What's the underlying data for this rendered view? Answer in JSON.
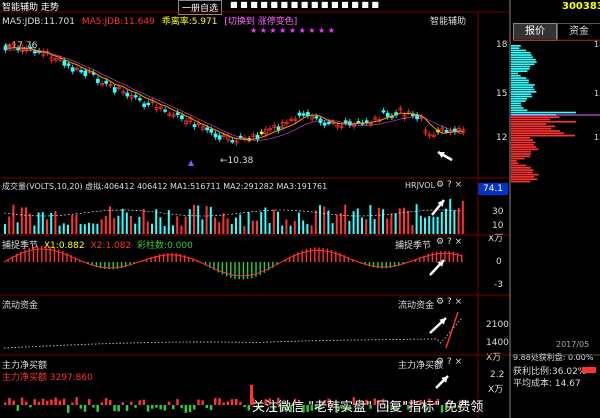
{
  "top_bar": {
    "left_tabs": "智能辅助 走势",
    "quick_menu": "一册自选"
  },
  "main_chart": {
    "legend": [
      "MA5:JDB:11.701",
      "MA5:JDB:11.649",
      "乖离率:5.971",
      "[切换到 涨停变色]"
    ],
    "tool_label": "智能辅助",
    "high_label": "17.76",
    "low_label": "10.38",
    "y_ticks": [
      "18",
      "15",
      "12"
    ]
  },
  "volume_panel": {
    "legend": "成交量(VOLTS,10,20) 虚拟:406412 406412 MA1:516711 MA2:291282 MA3:191761",
    "tool_label": "HRJVOL",
    "current_value": "74.1",
    "y_ticks": [
      "30",
      "10"
    ],
    "unit": "X万"
  },
  "indicator_panel": {
    "title": "捕捉季节",
    "legend_x1": "X1:0.882",
    "legend_x2": "X2:1.082",
    "legend_bar": "彩柱数:0.000",
    "tool_label": "捕捉季节",
    "y_ticks": [
      "0",
      "-3"
    ]
  },
  "flow_panel": {
    "title": "流动资金",
    "tool_label": "流动资金",
    "y_ticks": [
      "2100",
      "1400"
    ],
    "unit": "X万"
  },
  "main_net_panel": {
    "title": "主力净买额",
    "legend": "主力净买额 3297.860",
    "tool_label": "主力净买额",
    "y_ticks": [
      "2.2"
    ],
    "unit": "X万"
  },
  "right_panel": {
    "code": "300383",
    "tab_price": "报价",
    "tab_funds": "资金",
    "y_ticks": [
      "18",
      "15",
      "12"
    ],
    "info_lines": [
      "9.88处获利盘: 0.00%",
      "获利比例:36.02%",
      "平均成本: 14.67"
    ],
    "date": "2017/05"
  },
  "watermark": "关注微信 \"老韩实盘\" 回复\"指标\" 免费领",
  "colors": {
    "up": "#ff3333",
    "down": "#33ffff",
    "ma": "#ff9900",
    "green": "#33cc33",
    "yellow": "#ffff00",
    "magenta": "#ff33ff",
    "grid": "#7a0000"
  }
}
